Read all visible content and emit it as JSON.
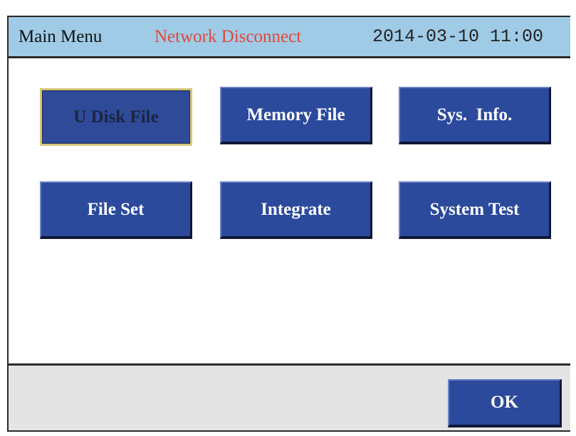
{
  "title_bar": {
    "title": "Main Menu",
    "status": "Network Disconnect",
    "datetime": "2014-03-10 11:00",
    "background_color": "#9fcbe6",
    "status_color": "#e0473c"
  },
  "menu": {
    "buttons": [
      {
        "label": "U Disk File",
        "enabled": false
      },
      {
        "label": "Memory File",
        "enabled": true
      },
      {
        "label": "Sys.  Info.",
        "enabled": true
      },
      {
        "label": "File Set",
        "enabled": true
      },
      {
        "label": "Integrate",
        "enabled": true
      },
      {
        "label": "System Test",
        "enabled": true
      }
    ],
    "button_color": "#2b4a9c"
  },
  "footer": {
    "ok_label": "OK"
  }
}
